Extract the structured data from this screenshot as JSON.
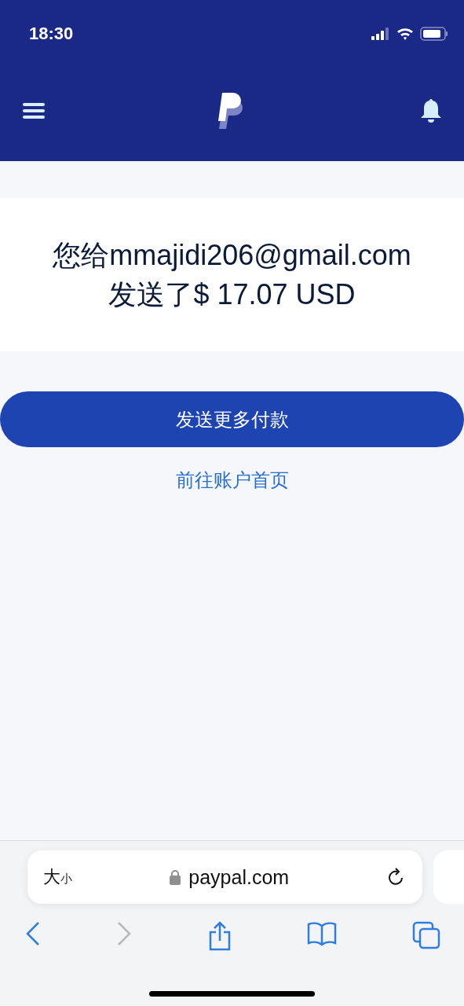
{
  "status_bar": {
    "time": "18:30"
  },
  "message": {
    "line_1": "您给mmajidi206@gmail.com",
    "line_2": "发送了$ 17.07 USD"
  },
  "primary_button": {
    "label": "发送更多付款"
  },
  "link": {
    "label": "前往账户首页"
  },
  "browser": {
    "text_size_large": "大",
    "text_size_small": "小",
    "url": "paypal.com",
    "forward_disabled": true
  }
}
